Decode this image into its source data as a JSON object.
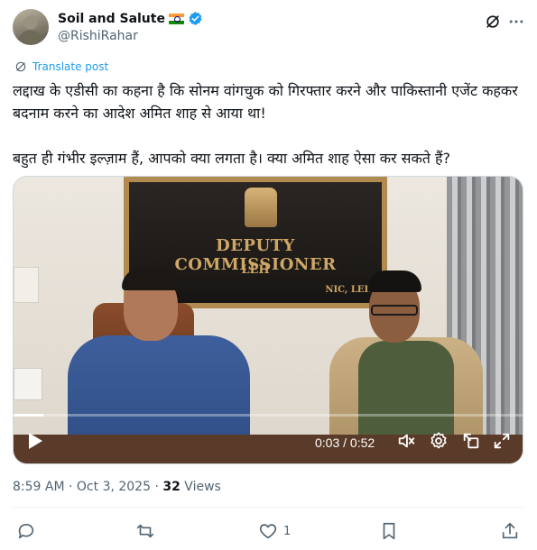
{
  "author": {
    "display_name": "Soil and Salute",
    "handle": "@RishiRahar",
    "flag_icon": "india-flag-icon",
    "verified_badge_color": "#1d9bf0"
  },
  "translate_label": "Translate post",
  "tweet": {
    "line1": "लद्दाख के एडीसी का कहना है कि सोनम वांगचुक को गिरफ्तार करने और पाकिस्तानी एजेंट कहकर बदनाम करने का आदेश अमित शाह से आया था!",
    "line2": "बहुत ही गंभीर इल्ज़ाम हैं, आपको क्या लगता है। क्या अमित शाह ऐसा कर सकते हैं?"
  },
  "video": {
    "plaque_title": "DEPUTY COMMISSIONER",
    "plaque_location": "LEH",
    "plaque_footer": "NIC, LEH",
    "time_display": "0:03 / 0:52",
    "progress_fraction": 0.0577
  },
  "meta": {
    "time": "8:59 AM",
    "separator": "·",
    "date": "Oct 3, 2025",
    "views_count": "32",
    "views_label": "Views"
  },
  "actions": {
    "likes_count": "1"
  },
  "colors": {
    "accent": "#1d9bf0",
    "text": "#0f1419",
    "muted": "#536471"
  }
}
